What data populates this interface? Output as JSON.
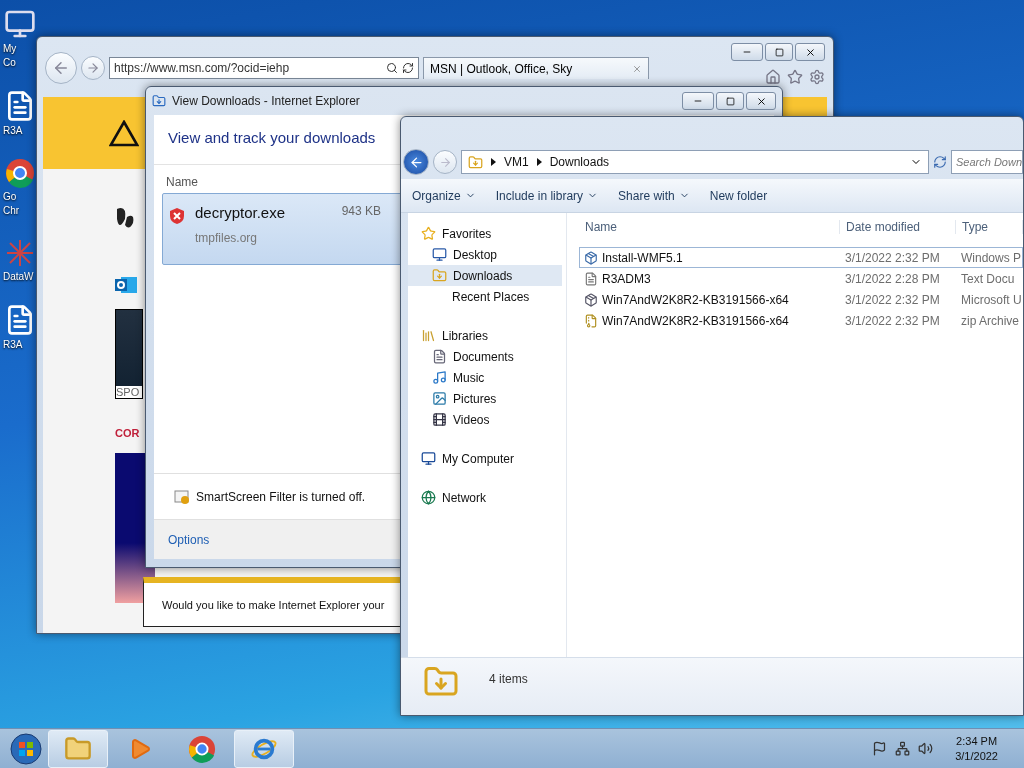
{
  "desktop_icons": [
    {
      "label": "My Co",
      "kind": "computer"
    },
    {
      "label": "R3A",
      "kind": "document"
    },
    {
      "label": "Go Chr",
      "kind": "chrome"
    },
    {
      "label": "DataW",
      "kind": "app"
    },
    {
      "label": "R3A",
      "kind": "document"
    }
  ],
  "browser": {
    "address": "https://www.msn.com/?ocid=iehp",
    "tab": "MSN | Outlook, Office, Sky",
    "caption": "SPO",
    "headline": "COR",
    "notification": "Would you like to make Internet Explorer your"
  },
  "downloads": {
    "title": "View Downloads - Internet Explorer",
    "heading": "View and track your downloads",
    "column": "Name",
    "items": [
      {
        "name": "decryptor.exe",
        "size": "943 KB",
        "source": "tmpfiles.org",
        "selected": true
      }
    ],
    "smartscreen": "SmartScreen Filter is turned off.",
    "options": "Options"
  },
  "explorer": {
    "path": [
      "VM1",
      "Downloads"
    ],
    "search_placeholder": "Search Down",
    "toolbar": [
      {
        "label": "Organize",
        "dropdown": true
      },
      {
        "label": "Include in library",
        "dropdown": true
      },
      {
        "label": "Share with",
        "dropdown": true
      },
      {
        "label": "New folder",
        "dropdown": false
      }
    ],
    "nav": [
      {
        "label": "Favorites",
        "kind": "star",
        "selected": false,
        "children": [
          {
            "label": "Desktop",
            "kind": "desktop",
            "selected": false
          },
          {
            "label": "Downloads",
            "kind": "downloads",
            "selected": true
          },
          {
            "label": "Recent Places",
            "kind": "recent",
            "selected": false
          }
        ]
      },
      {
        "label": "Libraries",
        "kind": "library",
        "selected": false,
        "children": [
          {
            "label": "Documents",
            "kind": "document",
            "selected": false
          },
          {
            "label": "Music",
            "kind": "music",
            "selected": false
          },
          {
            "label": "Pictures",
            "kind": "pictures",
            "selected": false
          },
          {
            "label": "Videos",
            "kind": "videos",
            "selected": false
          }
        ]
      },
      {
        "label": "My Computer",
        "kind": "computer",
        "selected": false
      },
      {
        "label": "Network",
        "kind": "network",
        "selected": false
      }
    ],
    "columns": [
      "Name",
      "Date modified",
      "Type"
    ],
    "files": [
      {
        "name": "Install-WMF5.1",
        "date": "3/1/2022 2:32 PM",
        "type": "Windows P",
        "kind": "installer",
        "focused": true
      },
      {
        "name": "R3ADM3",
        "date": "3/1/2022 2:28 PM",
        "type": "Text Docu",
        "kind": "text",
        "focused": false
      },
      {
        "name": "Win7AndW2K8R2-KB3191566-x64",
        "date": "3/1/2022 2:32 PM",
        "type": "Microsoft U",
        "kind": "update",
        "focused": false
      },
      {
        "name": "Win7AndW2K8R2-KB3191566-x64",
        "date": "3/1/2022 2:32 PM",
        "type": "zip Archive",
        "kind": "zip",
        "focused": false
      }
    ],
    "status": "4 items"
  },
  "taskbar": {
    "apps": [
      {
        "kind": "explorer",
        "active": true
      },
      {
        "kind": "media",
        "active": false
      },
      {
        "kind": "chrome",
        "active": false
      },
      {
        "kind": "ie",
        "active": true
      }
    ],
    "time": "2:34 PM",
    "date": "3/1/2022"
  }
}
